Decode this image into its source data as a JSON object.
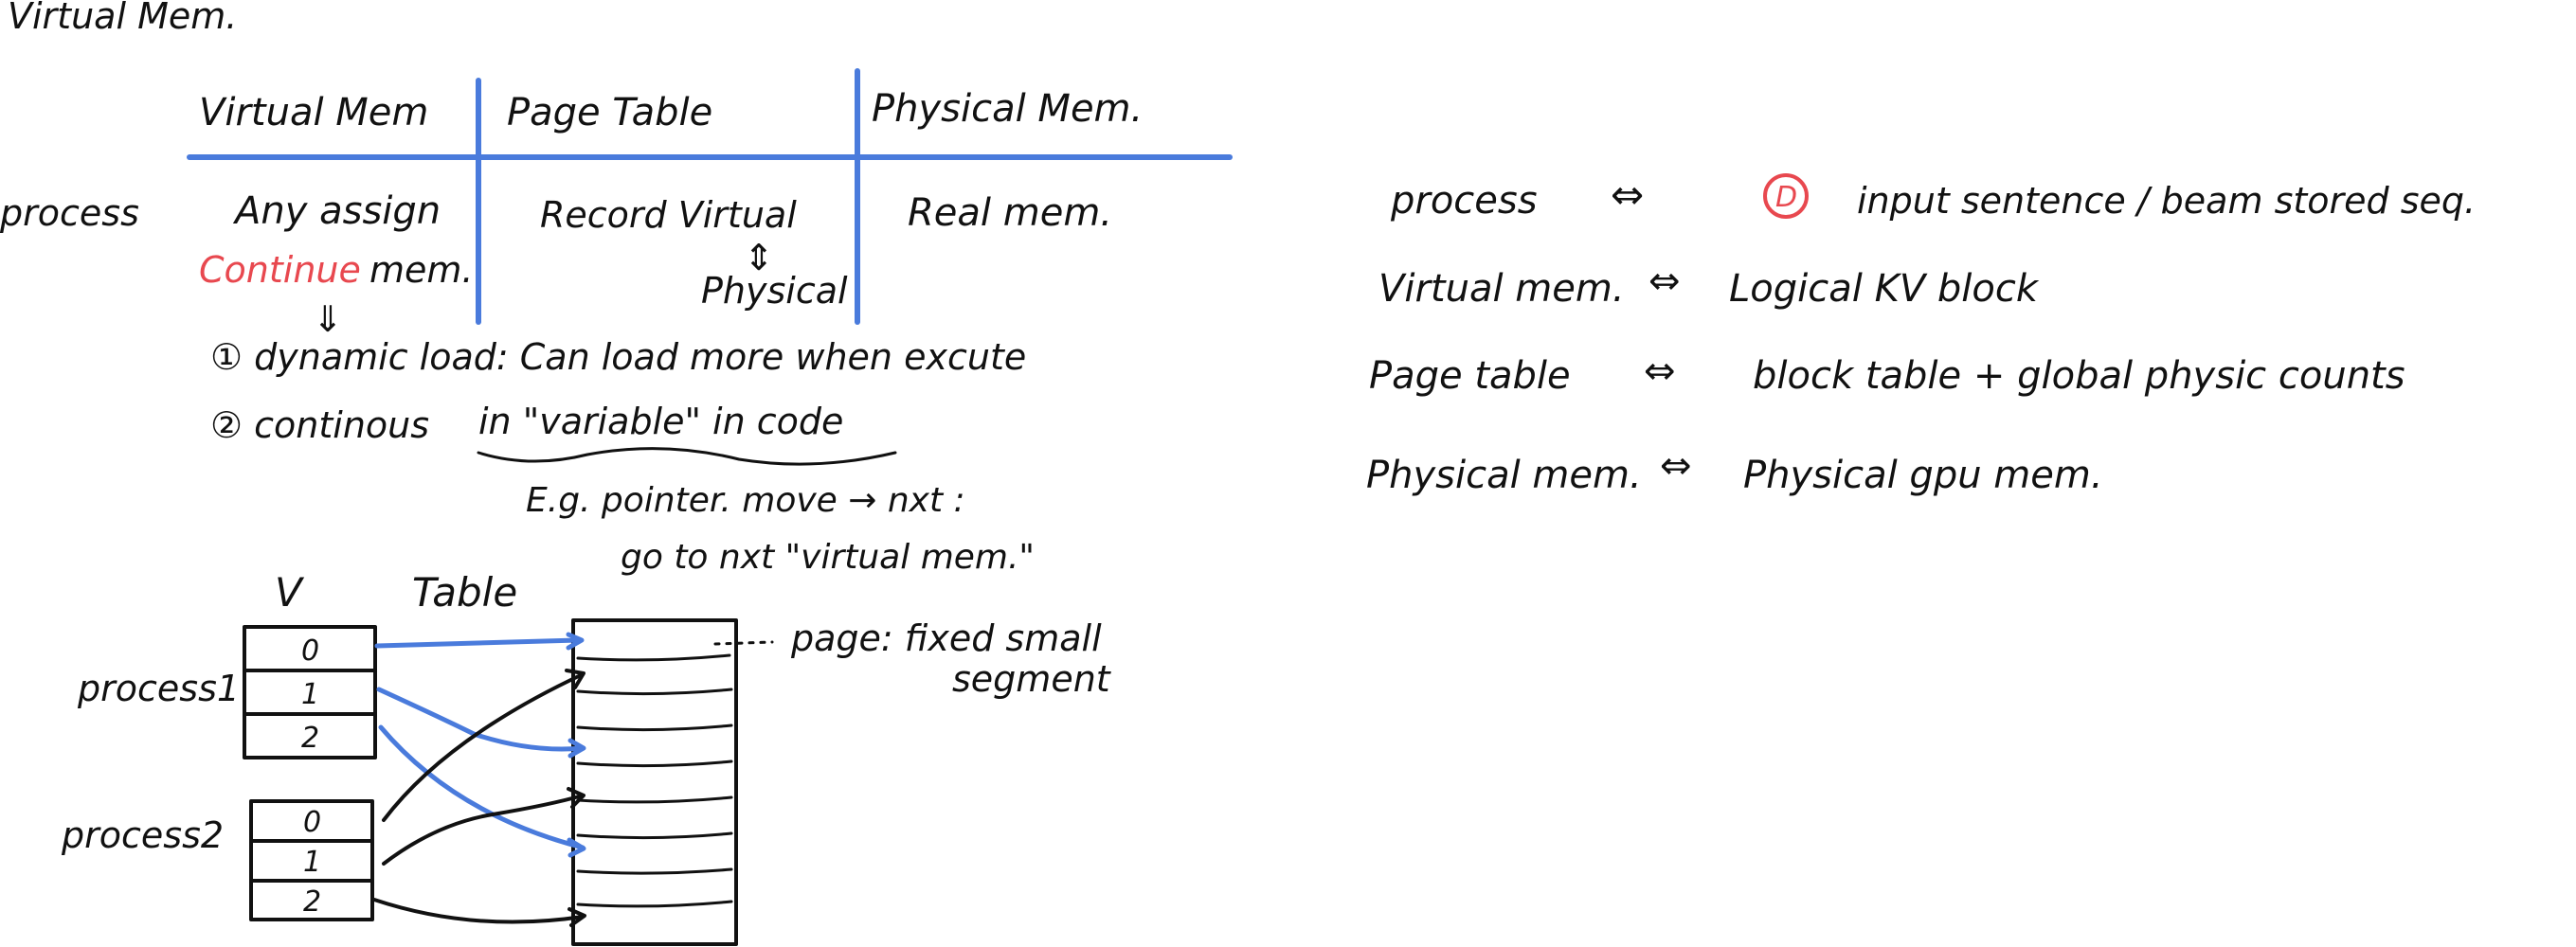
{
  "title": "Virtual Mem.",
  "table": {
    "headers": [
      "Virtual Mem",
      "Page Table",
      "Physical Mem."
    ],
    "row_label": "process",
    "col1_line1": "Any assign",
    "col1_highlight": "Continue",
    "col1_line2_rest": "mem.",
    "col2_line1": "Record Virtual",
    "col2_arrow": "⇕",
    "col2_line2": "Physical",
    "col3": "Real mem."
  },
  "notes": {
    "down_arrow": "⇓",
    "item1": "① dynamic load: Can load more when excute",
    "item2_prefix": "② continous",
    "item2_underlined": "in \"variable\" in code",
    "eg_line1": "E.g. pointer. move → nxt :",
    "eg_line2": "go to nxt \"virtual mem.\""
  },
  "diagram": {
    "v_label": "V",
    "table_label": "Table",
    "process1": "process1",
    "process2": "process2",
    "slots": [
      "0",
      "1",
      "2"
    ],
    "page_note_line1": "page: fixed small",
    "page_note_line2": "segment"
  },
  "mapping": {
    "rows": [
      {
        "left": "process",
        "arrow": "⇔",
        "right": "input sentence / beam stored seq."
      },
      {
        "left": "Virtual mem.",
        "arrow": "⇔",
        "right": "Logical KV block"
      },
      {
        "left": "Page table",
        "arrow": "⇔",
        "right": "block table + global physic counts"
      },
      {
        "left": "Physical mem.",
        "arrow": "⇔",
        "right": "Physical gpu mem."
      }
    ],
    "marker": "D"
  },
  "colors": {
    "ink": "#111111",
    "accent_blue": "#4a7bdc",
    "accent_red": "#e8484f"
  }
}
